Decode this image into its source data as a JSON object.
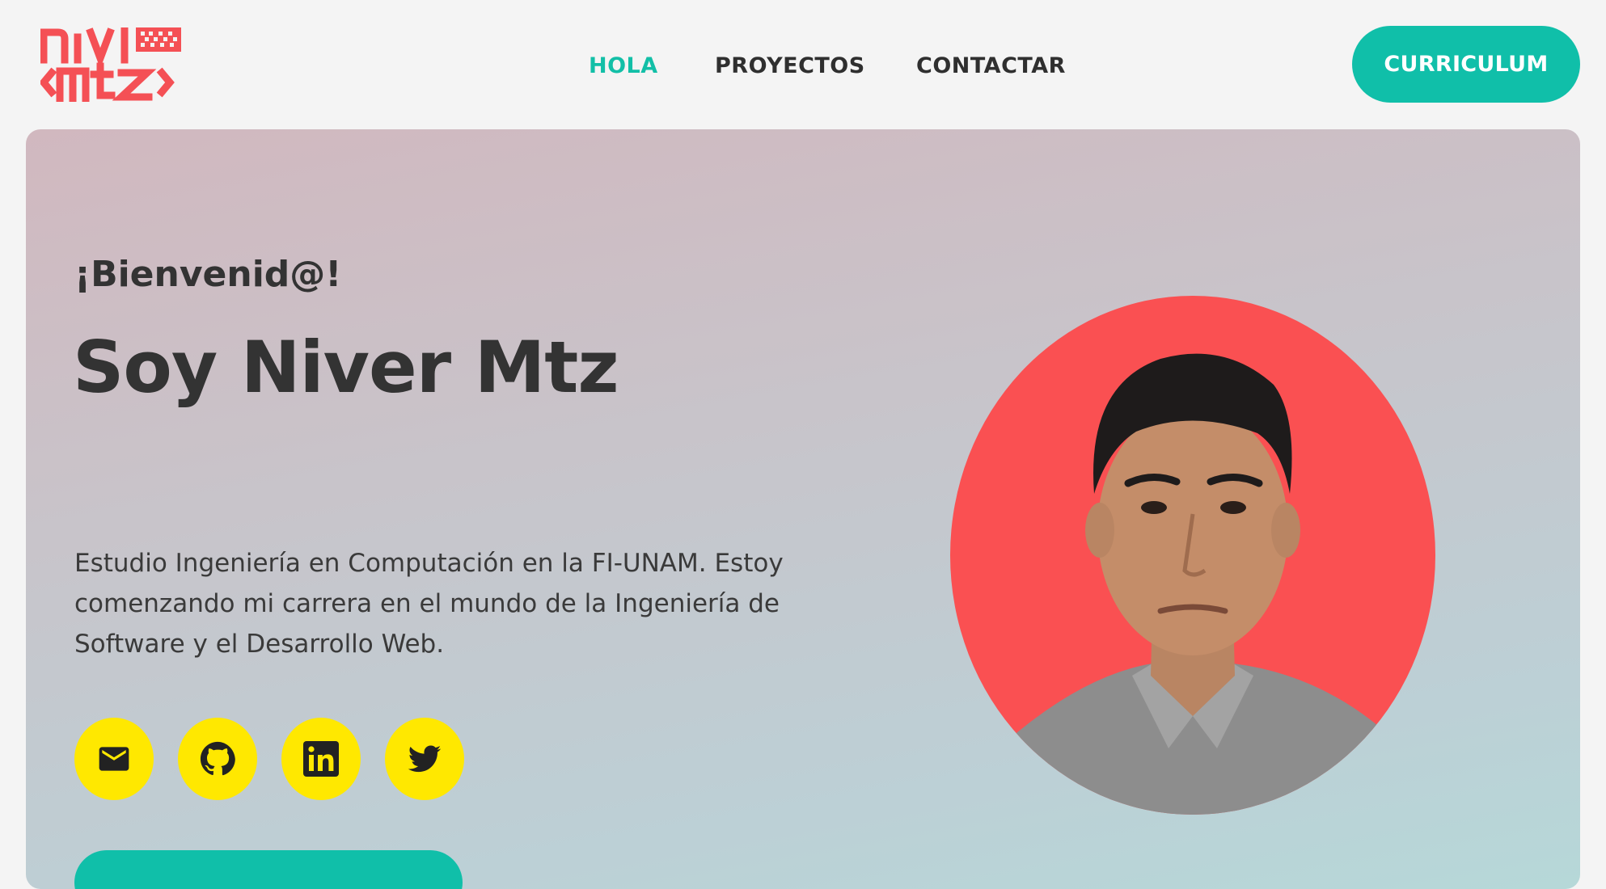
{
  "header": {
    "logo_alt": "nivl mtz",
    "nav": [
      {
        "label": "HOLA",
        "active": true
      },
      {
        "label": "PROYECTOS",
        "active": false
      },
      {
        "label": "CONTACTAR",
        "active": false
      }
    ],
    "cv_button_label": "CURRICULUM"
  },
  "hero": {
    "greeting": "¡Bienvenid@!",
    "title": "Soy Niver Mtz",
    "bio": "Estudio Ingeniería en Computación en la FI-UNAM. Estoy comenzando mi carrera en el mundo de la Ingeniería de Software y el Desarrollo Web.",
    "socials": [
      {
        "icon": "mail-icon"
      },
      {
        "icon": "github-icon"
      },
      {
        "icon": "linkedin-icon"
      },
      {
        "icon": "twitter-icon"
      }
    ]
  },
  "colors": {
    "accent": "#12bfa7",
    "brand_red": "#fa5052",
    "social_yellow": "#ffe800",
    "text_dark": "#333333",
    "page_bg": "#f4f4f4"
  }
}
